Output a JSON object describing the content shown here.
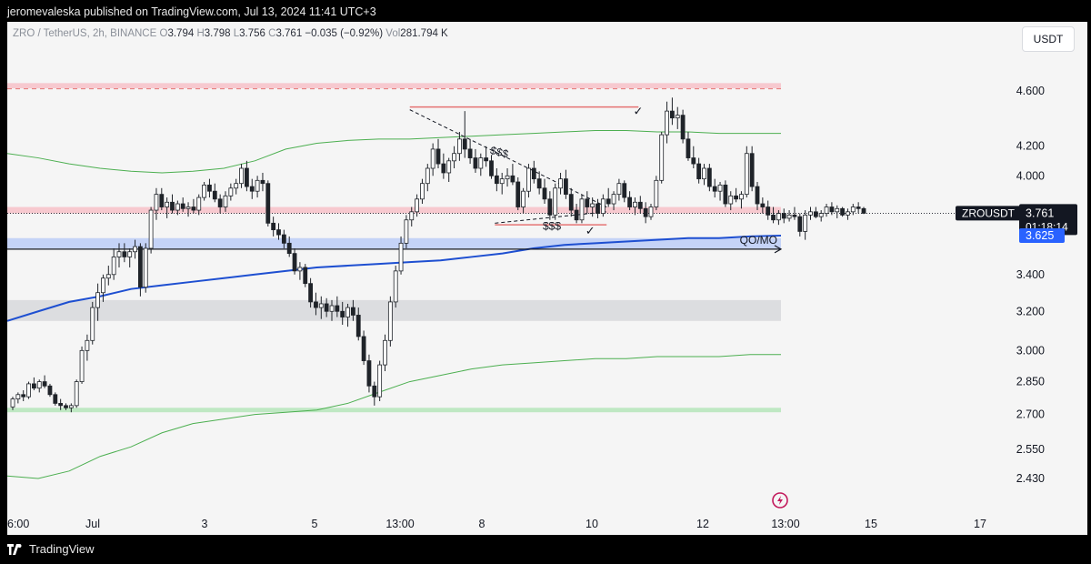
{
  "header": {
    "publisher_text": "jeromevaleska published on TradingView.com, Jul 13, 2024 11:41 UTC+3"
  },
  "legend": {
    "symbol": "ZRO / TetherUS, 2h, BINANCE",
    "open_label": "O",
    "open": "3.794",
    "high_label": "H",
    "high": "3.798",
    "low_label": "L",
    "low": "3.756",
    "close_label": "C",
    "close": "3.761",
    "change": "−0.035 (−0.92%)",
    "vol_label": "Vol",
    "vol": "281.794 K"
  },
  "currency_button": "USDT",
  "footer": {
    "brand": "TradingView"
  },
  "colors": {
    "candle": "#1f2329",
    "blue_ma": "#1e4fd1",
    "green_band": "#4caf50",
    "red_zone": "#f7c9cf",
    "blue_zone": "#c5d3f7",
    "gray_zone": "#dcdde0",
    "green_zone": "#bfe8c3",
    "red_line": "#e57373"
  },
  "chart_data": {
    "type": "candlestick",
    "symbol": "ZROUSDT",
    "interval": "2h",
    "y_axis": {
      "scale": "log",
      "ticks": [
        "4.600",
        "4.200",
        "4.000",
        "3.400",
        "3.200",
        "3.000",
        "2.850",
        "2.700",
        "2.550",
        "2.430"
      ]
    },
    "x_axis": {
      "ticks": [
        "6:00",
        "Jul",
        "3",
        "5",
        "13:00",
        "8",
        "10",
        "12",
        "13:00",
        "15",
        "17"
      ]
    },
    "last_price": {
      "label": "ZROUSDT",
      "value": "3.761",
      "countdown": "01:18:14"
    },
    "ma_price_label": "3.625",
    "annotations": {
      "liquidity_high": "$$$",
      "liquidity_low": "$$$",
      "level_label": "QO/MO",
      "check": "✓"
    },
    "candles": [
      [
        2.734,
        2.78,
        2.72,
        2.77
      ],
      [
        2.77,
        2.8,
        2.75,
        2.79
      ],
      [
        2.79,
        2.81,
        2.76,
        2.78
      ],
      [
        2.78,
        2.85,
        2.77,
        2.84
      ],
      [
        2.84,
        2.87,
        2.81,
        2.82
      ],
      [
        2.82,
        2.86,
        2.8,
        2.85
      ],
      [
        2.85,
        2.88,
        2.82,
        2.83
      ],
      [
        2.83,
        2.84,
        2.78,
        2.79
      ],
      [
        2.79,
        2.8,
        2.74,
        2.75
      ],
      [
        2.75,
        2.77,
        2.72,
        2.74
      ],
      [
        2.74,
        2.75,
        2.72,
        2.73
      ],
      [
        2.73,
        2.75,
        2.71,
        2.74
      ],
      [
        2.74,
        2.86,
        2.73,
        2.85
      ],
      [
        2.85,
        3.02,
        2.84,
        3.0
      ],
      [
        3.0,
        3.08,
        2.95,
        3.05
      ],
      [
        3.05,
        3.25,
        3.03,
        3.22
      ],
      [
        3.22,
        3.35,
        3.15,
        3.3
      ],
      [
        3.3,
        3.4,
        3.25,
        3.38
      ],
      [
        3.38,
        3.45,
        3.34,
        3.4
      ],
      [
        3.4,
        3.55,
        3.37,
        3.5
      ],
      [
        3.5,
        3.58,
        3.44,
        3.53
      ],
      [
        3.53,
        3.58,
        3.47,
        3.5
      ],
      [
        3.5,
        3.55,
        3.44,
        3.53
      ],
      [
        3.53,
        3.6,
        3.49,
        3.56
      ],
      [
        3.56,
        3.58,
        3.28,
        3.33
      ],
      [
        3.33,
        3.58,
        3.3,
        3.55
      ],
      [
        3.55,
        3.8,
        3.52,
        3.78
      ],
      [
        3.78,
        3.92,
        3.72,
        3.88
      ],
      [
        3.88,
        3.92,
        3.78,
        3.8
      ],
      [
        3.8,
        3.86,
        3.73,
        3.83
      ],
      [
        3.83,
        3.88,
        3.76,
        3.78
      ],
      [
        3.78,
        3.84,
        3.75,
        3.82
      ],
      [
        3.82,
        3.86,
        3.77,
        3.79
      ],
      [
        3.79,
        3.83,
        3.74,
        3.8
      ],
      [
        3.8,
        3.85,
        3.76,
        3.78
      ],
      [
        3.78,
        3.88,
        3.75,
        3.86
      ],
      [
        3.86,
        3.96,
        3.84,
        3.94
      ],
      [
        3.94,
        3.98,
        3.86,
        3.9
      ],
      [
        3.9,
        3.95,
        3.83,
        3.85
      ],
      [
        3.85,
        3.88,
        3.76,
        3.8
      ],
      [
        3.8,
        3.9,
        3.77,
        3.87
      ],
      [
        3.87,
        3.95,
        3.84,
        3.92
      ],
      [
        3.92,
        3.98,
        3.88,
        3.95
      ],
      [
        3.95,
        4.08,
        3.92,
        4.05
      ],
      [
        4.05,
        4.1,
        3.9,
        3.93
      ],
      [
        3.93,
        3.98,
        3.85,
        3.9
      ],
      [
        3.9,
        4.0,
        3.86,
        3.97
      ],
      [
        3.97,
        4.02,
        3.9,
        3.95
      ],
      [
        3.95,
        3.97,
        3.68,
        3.7
      ],
      [
        3.7,
        3.74,
        3.62,
        3.66
      ],
      [
        3.66,
        3.7,
        3.6,
        3.63
      ],
      [
        3.63,
        3.66,
        3.55,
        3.58
      ],
      [
        3.58,
        3.62,
        3.5,
        3.52
      ],
      [
        3.52,
        3.55,
        3.4,
        3.42
      ],
      [
        3.42,
        3.47,
        3.37,
        3.44
      ],
      [
        3.44,
        3.46,
        3.33,
        3.35
      ],
      [
        3.35,
        3.38,
        3.22,
        3.25
      ],
      [
        3.25,
        3.3,
        3.18,
        3.22
      ],
      [
        3.22,
        3.28,
        3.16,
        3.24
      ],
      [
        3.24,
        3.27,
        3.17,
        3.2
      ],
      [
        3.2,
        3.26,
        3.15,
        3.23
      ],
      [
        3.23,
        3.28,
        3.17,
        3.2
      ],
      [
        3.2,
        3.25,
        3.13,
        3.17
      ],
      [
        3.17,
        3.24,
        3.12,
        3.22
      ],
      [
        3.22,
        3.26,
        3.15,
        3.18
      ],
      [
        3.18,
        3.22,
        3.05,
        3.07
      ],
      [
        3.07,
        3.1,
        2.93,
        2.95
      ],
      [
        2.95,
        2.98,
        2.8,
        2.83
      ],
      [
        2.83,
        2.85,
        2.74,
        2.78
      ],
      [
        2.78,
        2.95,
        2.76,
        2.93
      ],
      [
        2.93,
        3.08,
        2.9,
        3.05
      ],
      [
        3.05,
        3.28,
        3.02,
        3.25
      ],
      [
        3.25,
        3.45,
        3.22,
        3.42
      ],
      [
        3.42,
        3.62,
        3.4,
        3.58
      ],
      [
        3.58,
        3.75,
        3.55,
        3.72
      ],
      [
        3.72,
        3.8,
        3.68,
        3.77
      ],
      [
        3.77,
        3.88,
        3.74,
        3.85
      ],
      [
        3.85,
        3.98,
        3.82,
        3.95
      ],
      [
        3.95,
        4.08,
        3.9,
        4.05
      ],
      [
        4.05,
        4.22,
        4.0,
        4.18
      ],
      [
        4.18,
        4.25,
        4.05,
        4.08
      ],
      [
        4.08,
        4.15,
        3.98,
        4.02
      ],
      [
        4.02,
        4.12,
        3.96,
        4.1
      ],
      [
        4.1,
        4.2,
        4.05,
        4.15
      ],
      [
        4.15,
        4.3,
        4.1,
        4.25
      ],
      [
        4.25,
        4.45,
        4.12,
        4.18
      ],
      [
        4.18,
        4.25,
        4.08,
        4.12
      ],
      [
        4.12,
        4.18,
        4.02,
        4.05
      ],
      [
        4.05,
        4.15,
        4.0,
        4.12
      ],
      [
        4.12,
        4.2,
        4.06,
        4.1
      ],
      [
        4.1,
        4.14,
        3.98,
        4.0
      ],
      [
        4.0,
        4.05,
        3.9,
        3.95
      ],
      [
        3.95,
        4.02,
        3.88,
        3.98
      ],
      [
        3.98,
        4.05,
        3.93,
        4.0
      ],
      [
        4.0,
        4.08,
        3.94,
        3.96
      ],
      [
        3.96,
        3.99,
        3.78,
        3.8
      ],
      [
        3.8,
        3.92,
        3.76,
        3.9
      ],
      [
        3.9,
        4.08,
        3.86,
        4.05
      ],
      [
        4.05,
        4.1,
        3.95,
        3.98
      ],
      [
        3.98,
        4.03,
        3.88,
        3.92
      ],
      [
        3.92,
        3.98,
        3.82,
        3.85
      ],
      [
        3.85,
        3.9,
        3.72,
        3.75
      ],
      [
        3.75,
        3.95,
        3.72,
        3.92
      ],
      [
        3.92,
        4.02,
        3.88,
        3.98
      ],
      [
        3.98,
        4.04,
        3.85,
        3.88
      ],
      [
        3.88,
        3.92,
        3.74,
        3.78
      ],
      [
        3.78,
        3.82,
        3.7,
        3.72
      ],
      [
        3.72,
        3.88,
        3.7,
        3.85
      ],
      [
        3.85,
        3.9,
        3.76,
        3.8
      ],
      [
        3.8,
        3.86,
        3.74,
        3.82
      ],
      [
        3.82,
        3.85,
        3.73,
        3.76
      ],
      [
        3.76,
        3.88,
        3.74,
        3.85
      ],
      [
        3.85,
        3.92,
        3.8,
        3.82
      ],
      [
        3.82,
        3.9,
        3.78,
        3.88
      ],
      [
        3.88,
        3.98,
        3.84,
        3.95
      ],
      [
        3.95,
        3.97,
        3.83,
        3.86
      ],
      [
        3.86,
        3.9,
        3.78,
        3.8
      ],
      [
        3.8,
        3.86,
        3.75,
        3.83
      ],
      [
        3.83,
        3.87,
        3.76,
        3.79
      ],
      [
        3.79,
        3.83,
        3.7,
        3.74
      ],
      [
        3.74,
        3.82,
        3.72,
        3.8
      ],
      [
        3.8,
        4.0,
        3.78,
        3.97
      ],
      [
        3.97,
        4.3,
        3.95,
        4.28
      ],
      [
        4.28,
        4.52,
        4.22,
        4.45
      ],
      [
        4.45,
        4.55,
        4.35,
        4.4
      ],
      [
        4.4,
        4.48,
        4.32,
        4.42
      ],
      [
        4.42,
        4.46,
        4.22,
        4.25
      ],
      [
        4.25,
        4.3,
        4.1,
        4.12
      ],
      [
        4.12,
        4.2,
        4.05,
        4.08
      ],
      [
        4.08,
        4.12,
        3.95,
        3.98
      ],
      [
        3.98,
        4.08,
        3.94,
        4.05
      ],
      [
        4.05,
        4.08,
        3.9,
        3.93
      ],
      [
        3.93,
        3.98,
        3.86,
        3.9
      ],
      [
        3.9,
        3.96,
        3.84,
        3.94
      ],
      [
        3.94,
        3.97,
        3.8,
        3.82
      ],
      [
        3.82,
        3.9,
        3.78,
        3.87
      ],
      [
        3.87,
        3.92,
        3.83,
        3.85
      ],
      [
        3.85,
        3.9,
        3.79,
        3.88
      ],
      [
        3.88,
        4.2,
        3.86,
        4.15
      ],
      [
        4.15,
        4.2,
        3.9,
        3.93
      ],
      [
        3.93,
        3.96,
        3.78,
        3.82
      ],
      [
        3.82,
        3.86,
        3.76,
        3.8
      ],
      [
        3.8,
        3.84,
        3.72,
        3.75
      ],
      [
        3.75,
        3.8,
        3.7,
        3.72
      ],
      [
        3.72,
        3.78,
        3.69,
        3.76
      ],
      [
        3.76,
        3.79,
        3.7,
        3.73
      ],
      [
        3.73,
        3.78,
        3.71,
        3.75
      ],
      [
        3.75,
        3.8,
        3.72,
        3.74
      ],
      [
        3.74,
        3.76,
        3.62,
        3.65
      ],
      [
        3.65,
        3.78,
        3.6,
        3.75
      ],
      [
        3.75,
        3.8,
        3.72,
        3.77
      ],
      [
        3.77,
        3.8,
        3.73,
        3.74
      ],
      [
        3.74,
        3.78,
        3.71,
        3.76
      ],
      [
        3.76,
        3.82,
        3.74,
        3.8
      ],
      [
        3.8,
        3.83,
        3.75,
        3.77
      ],
      [
        3.77,
        3.81,
        3.73,
        3.79
      ],
      [
        3.79,
        3.8,
        3.74,
        3.75
      ],
      [
        3.75,
        3.79,
        3.72,
        3.77
      ],
      [
        3.77,
        3.82,
        3.75,
        3.8
      ],
      [
        3.8,
        3.83,
        3.76,
        3.79
      ],
      [
        3.79,
        3.8,
        3.756,
        3.761
      ]
    ],
    "levels": {
      "red_zone_top": [
        4.62,
        4.66
      ],
      "red_zone_mid": [
        3.76,
        3.8
      ],
      "blue_zone": [
        3.55,
        3.61
      ],
      "gray_zone": [
        3.15,
        3.26
      ],
      "green_zone": [
        2.71,
        2.73
      ],
      "range_high_line": 4.48,
      "range_low_line": 3.69,
      "qo_mo_line": 3.545
    },
    "series": [
      {
        "values": [
          3.15,
          3.2,
          3.25,
          3.28,
          3.32,
          3.34,
          3.36,
          3.38,
          3.4,
          3.42,
          3.44,
          3.45,
          3.46,
          3.47,
          3.48,
          3.5,
          3.52,
          3.55,
          3.57,
          3.58,
          3.59,
          3.6,
          3.61,
          3.61,
          3.62,
          3.625
        ]
      },
      {
        "values": [
          4.15,
          4.12,
          4.08,
          4.05,
          4.03,
          4.02,
          4.03,
          4.05,
          4.1,
          4.18,
          4.22,
          4.24,
          4.25,
          4.25,
          4.26,
          4.27,
          4.28,
          4.29,
          4.3,
          4.31,
          4.31,
          4.3,
          4.3,
          4.29,
          4.29,
          4.29
        ]
      },
      {
        "values": [
          2.44,
          2.43,
          2.46,
          2.52,
          2.56,
          2.62,
          2.66,
          2.68,
          2.7,
          2.71,
          2.72,
          2.75,
          2.8,
          2.85,
          2.88,
          2.91,
          2.93,
          2.94,
          2.95,
          2.96,
          2.96,
          2.97,
          2.97,
          2.97,
          2.98,
          2.98
        ]
      }
    ]
  }
}
